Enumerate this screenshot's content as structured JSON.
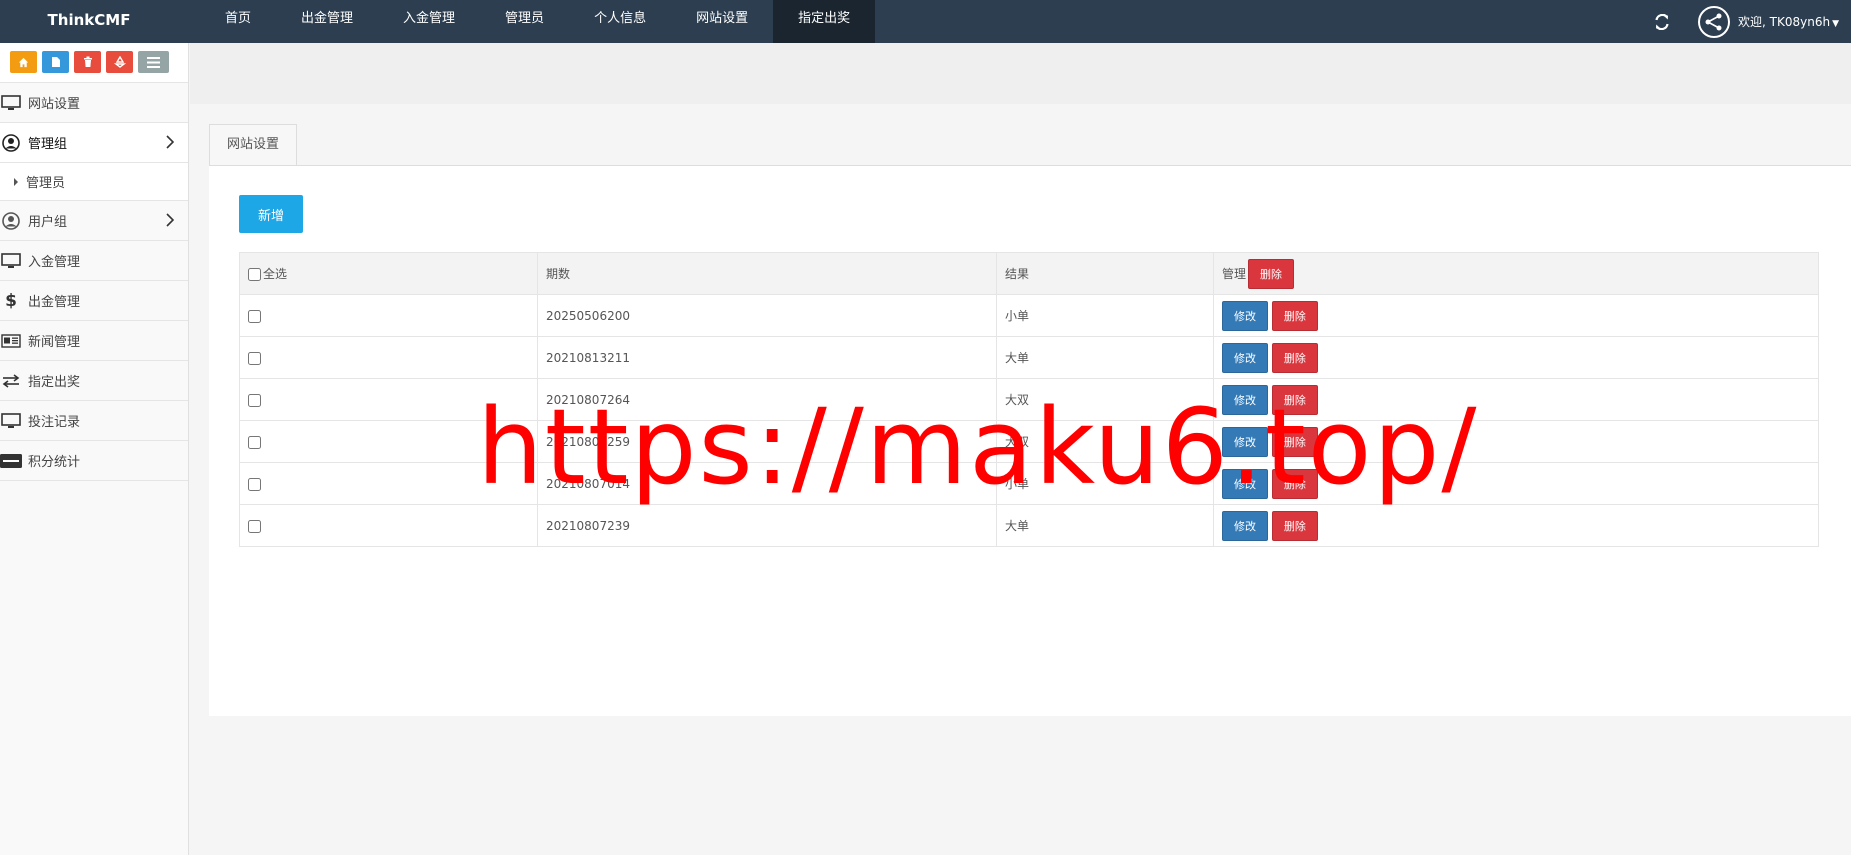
{
  "brand": "ThinkCMF",
  "nav": [
    {
      "label": "首页"
    },
    {
      "label": "出金管理"
    },
    {
      "label": "入金管理"
    },
    {
      "label": "管理员"
    },
    {
      "label": "个人信息"
    },
    {
      "label": "网站设置"
    },
    {
      "label": "指定出奖",
      "active": true
    }
  ],
  "user": {
    "welcome": "欢迎, TK08yn6h"
  },
  "sidebar": {
    "quick_buttons": [
      {
        "icon": "home-icon",
        "color": "#f39c12"
      },
      {
        "icon": "file-icon",
        "color": "#3498db"
      },
      {
        "icon": "trash-icon",
        "color": "#e74c3c"
      },
      {
        "icon": "recycle-icon",
        "color": "#e74c3c"
      },
      {
        "icon": "list-icon",
        "color": "#95a5a6"
      }
    ],
    "items": [
      {
        "label": "网站设置",
        "icon": "monitor-icon"
      },
      {
        "label": "管理组",
        "icon": "user-circle-icon",
        "open": true,
        "children": [
          {
            "label": "管理员"
          }
        ]
      },
      {
        "label": "用户组",
        "icon": "user-circle-icon"
      },
      {
        "label": "入金管理",
        "icon": "monitor-icon"
      },
      {
        "label": "出金管理",
        "icon": "dollar-icon"
      },
      {
        "label": "新闻管理",
        "icon": "newspaper-icon"
      },
      {
        "label": "指定出奖",
        "icon": "exchange-icon"
      },
      {
        "label": "投注记录",
        "icon": "monitor-icon"
      },
      {
        "label": "积分统计",
        "icon": "visa-icon"
      }
    ]
  },
  "main": {
    "tab": "网站设置",
    "new_button": "新增",
    "table": {
      "headers": {
        "select_all": "全选",
        "period": "期数",
        "result": "结果",
        "manage": "管理"
      },
      "header_delete": "删除",
      "edit_label": "修改",
      "delete_label": "删除",
      "rows": [
        {
          "period": "20250506200",
          "result": "小单"
        },
        {
          "period": "20210813211",
          "result": "大单"
        },
        {
          "period": "20210807264",
          "result": "大双"
        },
        {
          "period": "20210807259",
          "result": "大双"
        },
        {
          "period": "20210807014",
          "result": "小单"
        },
        {
          "period": "20210807239",
          "result": "大单"
        }
      ]
    }
  },
  "watermark": "https://maku6.top/"
}
